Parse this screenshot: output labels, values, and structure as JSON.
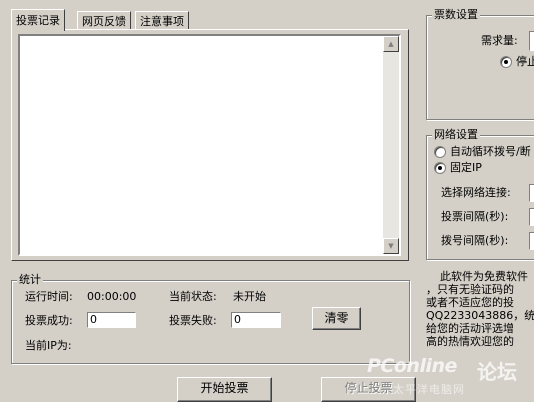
{
  "tabs": [
    {
      "label": "投票记录",
      "active": true
    },
    {
      "label": "网页反馈",
      "active": false
    },
    {
      "label": "注意事项",
      "active": false
    }
  ],
  "vote_settings": {
    "title": "票数设置",
    "required_label": "需求量:",
    "stop_label": "停止"
  },
  "network": {
    "title": "网络设置",
    "option_auto": "自动循环拨号/断",
    "option_fixed": "固定IP",
    "select_label": "选择网络连接:",
    "vote_interval_label": "投票间隔(秒):",
    "dial_interval_label": "拨号间隔(秒):"
  },
  "stats": {
    "title": "统计",
    "run_time_label": "运行时间:",
    "run_time_value": "00:00:00",
    "state_label": "当前状态:",
    "state_value": "未开始",
    "success_label": "投票成功:",
    "success_value": "0",
    "fail_label": "投票失败:",
    "fail_value": "0",
    "ip_label": "当前IP为:",
    "clear_button": "清零"
  },
  "buttons": {
    "start": "开始投票",
    "stop": "停止投票"
  },
  "info_lines": [
    "此软件为免费软件",
    "，只有无验证码的",
    "或者不适应您的投",
    "QQ2233043886，统",
    "给您的活动评选增",
    "高的热情欢迎您的"
  ],
  "watermark": {
    "brand": "PConline",
    "forum": "论坛",
    "sub": "太平洋电脑网"
  }
}
